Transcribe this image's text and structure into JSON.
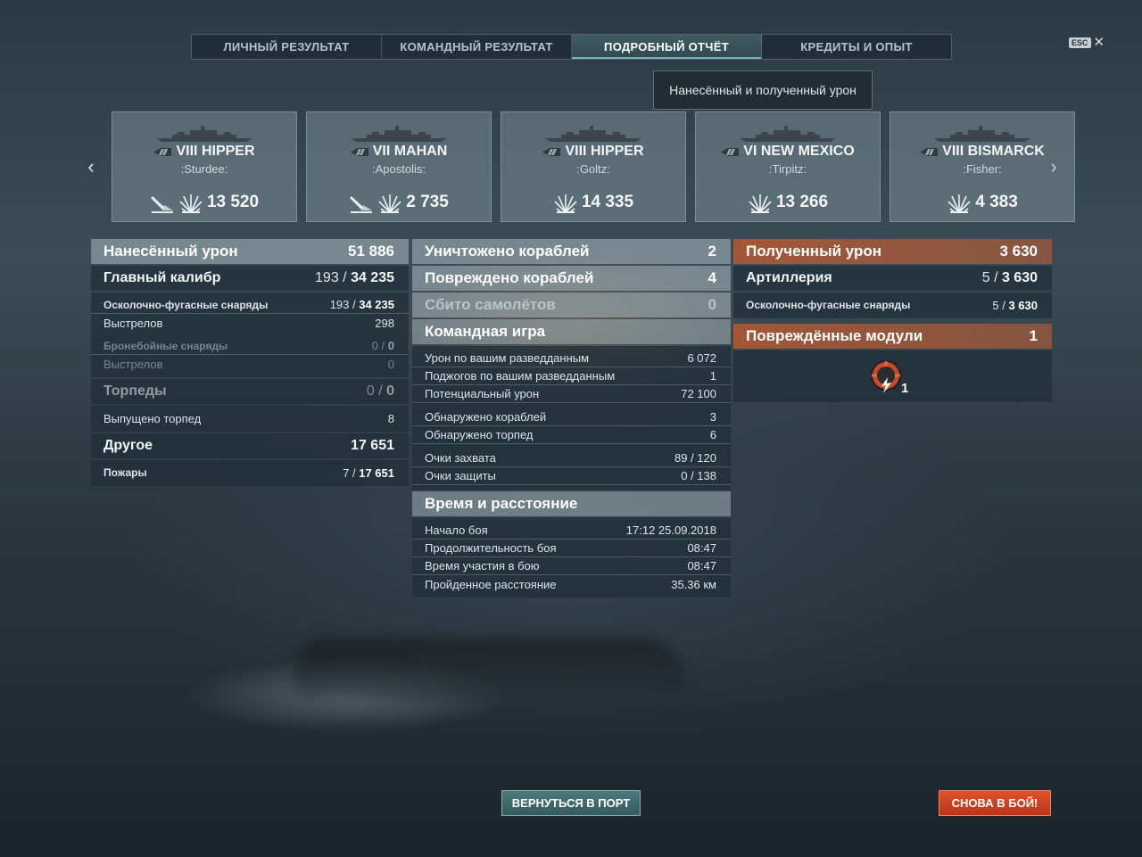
{
  "tabs": [
    {
      "label": "ЛИЧНЫЙ РЕЗУЛЬТАТ",
      "active": false
    },
    {
      "label": "КОМАНДНЫЙ РЕЗУЛЬТАТ",
      "active": false
    },
    {
      "label": "ПОДРОБНЫЙ ОТЧЁТ",
      "active": true
    },
    {
      "label": "КРЕДИТЫ И ОПЫТ",
      "active": false
    }
  ],
  "esc": {
    "key": "ESC",
    "close": "✕"
  },
  "tooltip": "Нанесённый и полученный урон",
  "ships": [
    {
      "name": "VIII HIPPER",
      "player": ":Sturdee:",
      "damage": "13 520",
      "icons": [
        "torpedo-hit-icon",
        "explosion-icon"
      ]
    },
    {
      "name": "VII MAHAN",
      "player": ":Apostolis:",
      "damage": "2 735",
      "icons": [
        "torpedo-hit-icon",
        "explosion-icon"
      ]
    },
    {
      "name": "VIII HIPPER",
      "player": ":Goltz:",
      "damage": "14 335",
      "icons": [
        "explosion-icon"
      ]
    },
    {
      "name": "VI NEW MEXICO",
      "player": ":Tirpitz:",
      "damage": "13 266",
      "icons": [
        "explosion-icon"
      ]
    },
    {
      "name": "VIII BISMARCK",
      "player": ":Fisher:",
      "damage": "4 383",
      "icons": [
        "explosion-icon"
      ]
    }
  ],
  "left": {
    "dealt_label": "Нанесённый урон",
    "dealt_value": "51 886",
    "main_label": "Главный калибр",
    "main_hits": "193 / ",
    "main_dmg": "34 235",
    "he_label": "Осколочно-фугасные снаряды",
    "he_hits": "193 / ",
    "he_dmg": "34 235",
    "he_shots_label": "Выстрелов",
    "he_shots": "298",
    "ap_label": "Бронебойные снаряды",
    "ap_hits": "0 / ",
    "ap_dmg": "0",
    "ap_shots_label": "Выстрелов",
    "ap_shots": "0",
    "torp_label": "Торпеды",
    "torp_hits": "0 / ",
    "torp_dmg": "0",
    "torp_fired_label": "Выпущено торпед",
    "torp_fired": "8",
    "other_label": "Другое",
    "other_value": "17 651",
    "fires_label": "Пожары",
    "fires_hits": "7 / ",
    "fires_dmg": "17 651"
  },
  "mid": {
    "destroyed_label": "Уничтожено кораблей",
    "destroyed": "2",
    "damaged_label": "Повреждено кораблей",
    "damaged": "4",
    "planes_label": "Сбито самолётов",
    "planes": "0",
    "team_label": "Командная игра",
    "spot_dmg_label": "Урон по вашим разведданным",
    "spot_dmg": "6 072",
    "spot_fire_label": "Поджогов по вашим разведданным",
    "spot_fire": "1",
    "potential_label": "Потенциальный урон",
    "potential": "72 100",
    "ships_spotted_label": "Обнаружено кораблей",
    "ships_spotted": "3",
    "torps_spotted_label": "Обнаружено торпед",
    "torps_spotted": "6",
    "capture_label": "Очки захвата",
    "capture": "89 / 120",
    "defense_label": "Очки защиты",
    "defense": "0 / 138",
    "time_label": "Время и расстояние",
    "start_label": "Начало боя",
    "start": "17:12  25.09.2018",
    "duration_label": "Продолжительность боя",
    "duration": "08:47",
    "participation_label": "Время участия в бою",
    "participation": "08:47",
    "distance_label": "Пройденное расстояние",
    "distance": "35.36 км"
  },
  "right": {
    "received_label": "Полученный урон",
    "received": "3 630",
    "artillery_label": "Артиллерия",
    "artillery_hits": "5 / ",
    "artillery_dmg": "3 630",
    "he_label": "Осколочно-фугасные снаряды",
    "he_hits": "5 / ",
    "he_dmg": "3 630",
    "modules_label": "Повреждённые модули",
    "modules": "1",
    "module_count": "1"
  },
  "buttons": {
    "port": "ВЕРНУТЬСЯ В ПОРТ",
    "battle": "СНОВА В БОЙ!"
  }
}
